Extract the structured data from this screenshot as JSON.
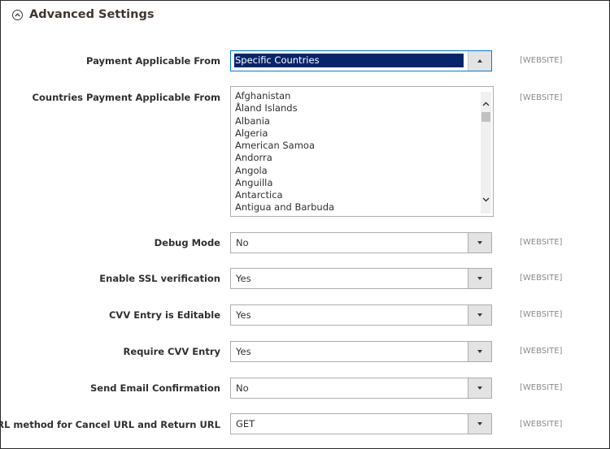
{
  "section": {
    "title": "Advanced Settings",
    "toggle_icon": "chevron-up-circle-icon"
  },
  "fields": [
    {
      "label": "Payment Applicable From",
      "value": "Specific Countries",
      "scope": "[WEBSITE]",
      "state": "open"
    },
    {
      "label": "Countries Payment Applicable From",
      "scope": "[WEBSITE]",
      "type": "multiselect",
      "options": [
        "Afghanistan",
        "Åland Islands",
        "Albania",
        "Algeria",
        "American Samoa",
        "Andorra",
        "Angola",
        "Anguilla",
        "Antarctica",
        "Antigua and Barbuda"
      ]
    },
    {
      "label": "Debug Mode",
      "value": "No",
      "scope": "[WEBSITE]"
    },
    {
      "label": "Enable SSL verification",
      "value": "Yes",
      "scope": "[WEBSITE]"
    },
    {
      "label": "CVV Entry is Editable",
      "value": "Yes",
      "scope": "[WEBSITE]"
    },
    {
      "label": "Require CVV Entry",
      "value": "Yes",
      "scope": "[WEBSITE]"
    },
    {
      "label": "Send Email Confirmation",
      "value": "No",
      "scope": "[WEBSITE]"
    },
    {
      "label": "URL method for Cancel URL and Return URL",
      "value": "GET",
      "scope": "[WEBSITE]"
    }
  ],
  "colors": {
    "selection_bg": "#0a246a",
    "focus_border": "#007bdb",
    "scope_text": "#8a8a8a"
  }
}
